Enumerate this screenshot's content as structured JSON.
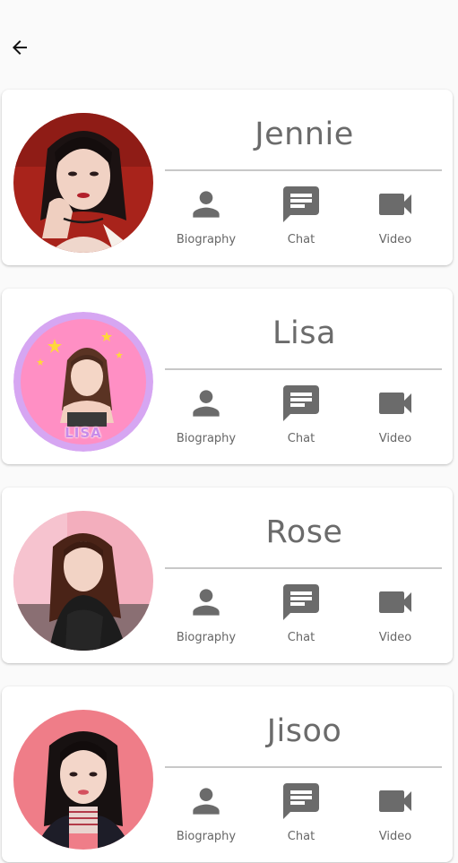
{
  "colors": {
    "background": "#fafafa",
    "card": "#ffffff",
    "icon": "#6b6b6b",
    "divider": "#c8c8c8"
  },
  "header": {
    "back_icon": "arrow-left-icon"
  },
  "cards": [
    {
      "name": "Jennie",
      "actions": {
        "biography": "Biography",
        "chat": "Chat",
        "video": "Video"
      }
    },
    {
      "name": "Lisa",
      "badge_text": "LISA",
      "actions": {
        "biography": "Biography",
        "chat": "Chat",
        "video": "Video"
      }
    },
    {
      "name": "Rose",
      "actions": {
        "biography": "Biography",
        "chat": "Chat",
        "video": "Video"
      }
    },
    {
      "name": "Jisoo",
      "actions": {
        "biography": "Biography",
        "chat": "Chat",
        "video": "Video"
      }
    }
  ]
}
